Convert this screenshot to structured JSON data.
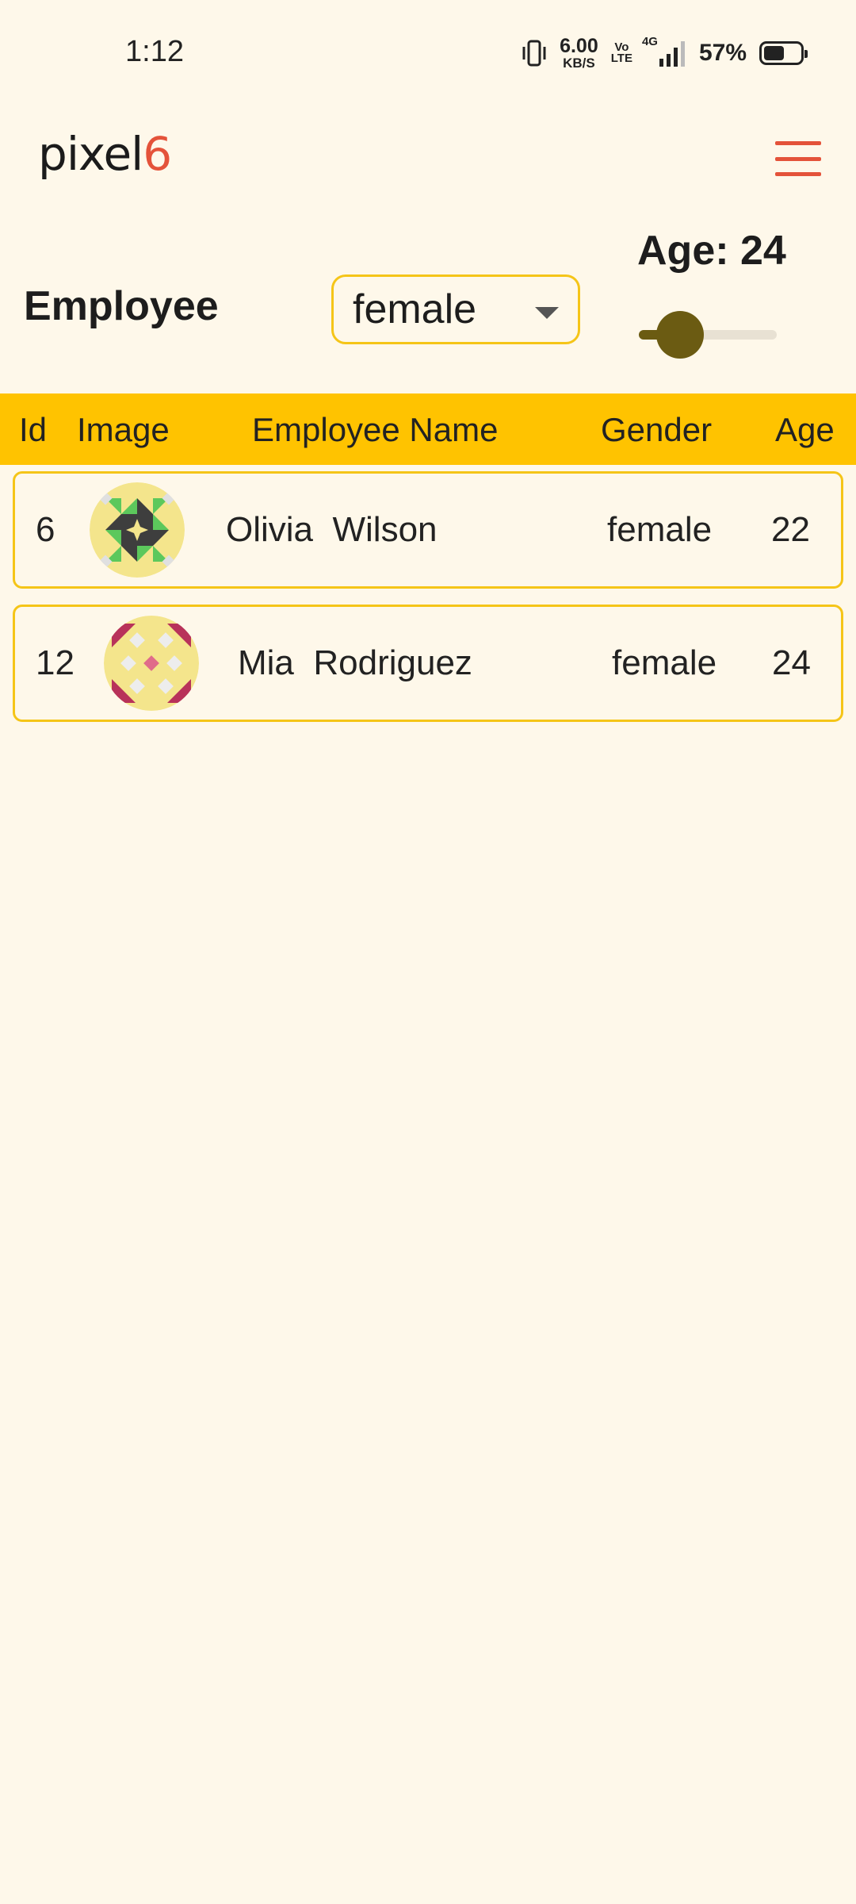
{
  "status_bar": {
    "time": "1:12",
    "net_speed_value": "6.00",
    "net_speed_unit": "KB/S",
    "volte_top": "Vo",
    "volte_bottom": "LTE",
    "network_type": "4G",
    "battery_percent": "57%",
    "battery_level": 0.57
  },
  "app_bar": {
    "logo_text": "pixel",
    "logo_accent": "6",
    "accent_color": "#E4533A",
    "menu_icon": "hamburger-menu-icon"
  },
  "filters": {
    "section_label": "Employee",
    "gender_value": "female",
    "age_label": "Age: 24",
    "age_value": 24,
    "age_slider_fraction": 0.3
  },
  "table": {
    "header_color": "#FFC300",
    "columns": [
      "Id",
      "Image",
      "Employee Name",
      "Gender",
      "Age"
    ],
    "rows": [
      {
        "id": "6",
        "first_name": "Olivia",
        "last_name": "Wilson",
        "gender": "female",
        "age": "22",
        "avatar_icon": "green-quilt-avatar-icon"
      },
      {
        "id": "12",
        "first_name": "Mia",
        "last_name": "Rodriguez",
        "gender": "female",
        "age": "24",
        "avatar_icon": "pink-quilt-avatar-icon"
      }
    ]
  }
}
